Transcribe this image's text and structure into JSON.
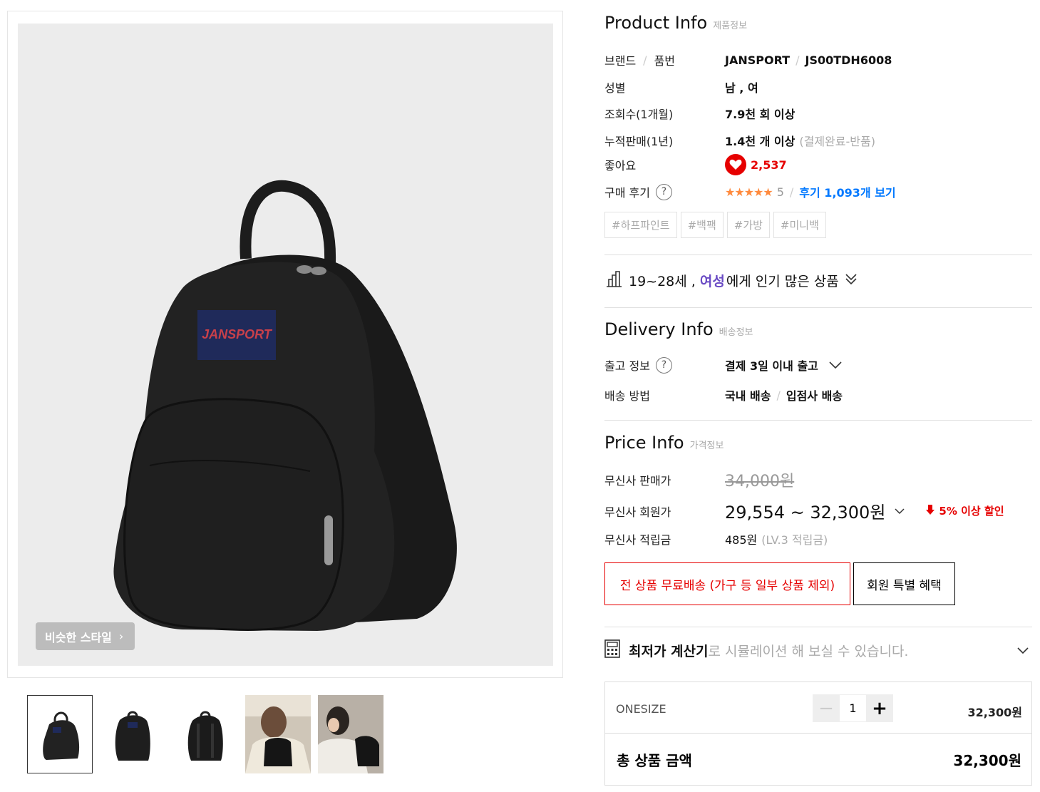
{
  "gallery": {
    "similar_style_label": "비슷한 스타일",
    "thumbnails": [
      "thumb-front",
      "thumb-side",
      "thumb-back",
      "thumb-model-back",
      "thumb-model-side"
    ]
  },
  "product_info": {
    "title_en": "Product Info",
    "title_ko": "제품정보",
    "brand_label": "브랜드",
    "code_label": "품번",
    "brand": "JANSPORT",
    "code": "JS00TDH6008",
    "gender_label": "성별",
    "gender": "남 , 여",
    "views_label": "조회수(1개월)",
    "views": "7.9천 회 이상",
    "sales_label": "누적판매(1년)",
    "sales": "1.4천 개 이상",
    "sales_note": "(결제완료-반품)",
    "likes_label": "좋아요",
    "likes": "2,537",
    "review_label": "구매 후기",
    "rating_stars": "★★★★★",
    "rating": "5",
    "review_link": "후기 1,093개 보기",
    "tags": [
      "#하프파인트",
      "#백팩",
      "#가방",
      "#미니백"
    ]
  },
  "popular": {
    "age": "19~28세 ,",
    "gender": "여성",
    "rest": "에게 인기 많은 상품"
  },
  "delivery_info": {
    "title_en": "Delivery Info",
    "title_ko": "배송정보",
    "release_label": "출고 정보",
    "release": "결제 3일 이내 출고",
    "method_label": "배송 방법",
    "method_a": "국내 배송",
    "method_b": "입점사 배송"
  },
  "price_info": {
    "title_en": "Price Info",
    "title_ko": "가격정보",
    "sale_label": "무신사 판매가",
    "sale_price": "34,000원",
    "member_label": "무신사 회원가",
    "member_price": "29,554 ~ 32,300원",
    "discount": "5% 이상 할인",
    "points_label": "무신사 적립금",
    "points": "485원",
    "points_note": "(LV.3 적립금)",
    "free_shipping": "전 상품 무료배송 (가구 등 일부 상품 제외)",
    "member_benefit": "회원 특별 혜택"
  },
  "calculator": {
    "bold": "최저가 계산기",
    "rest": "로 시뮬레이션 해 보실 수 있습니다."
  },
  "option": {
    "name": "ONESIZE",
    "qty": "1",
    "price": "32,300원",
    "total_label": "총 상품 금액",
    "total_price": "32,300원"
  },
  "colors": {
    "accent_red": "#e60000",
    "link_blue": "#0078ff",
    "popular_purple": "#6a4bc4",
    "star_orange": "#ff8a3d"
  }
}
